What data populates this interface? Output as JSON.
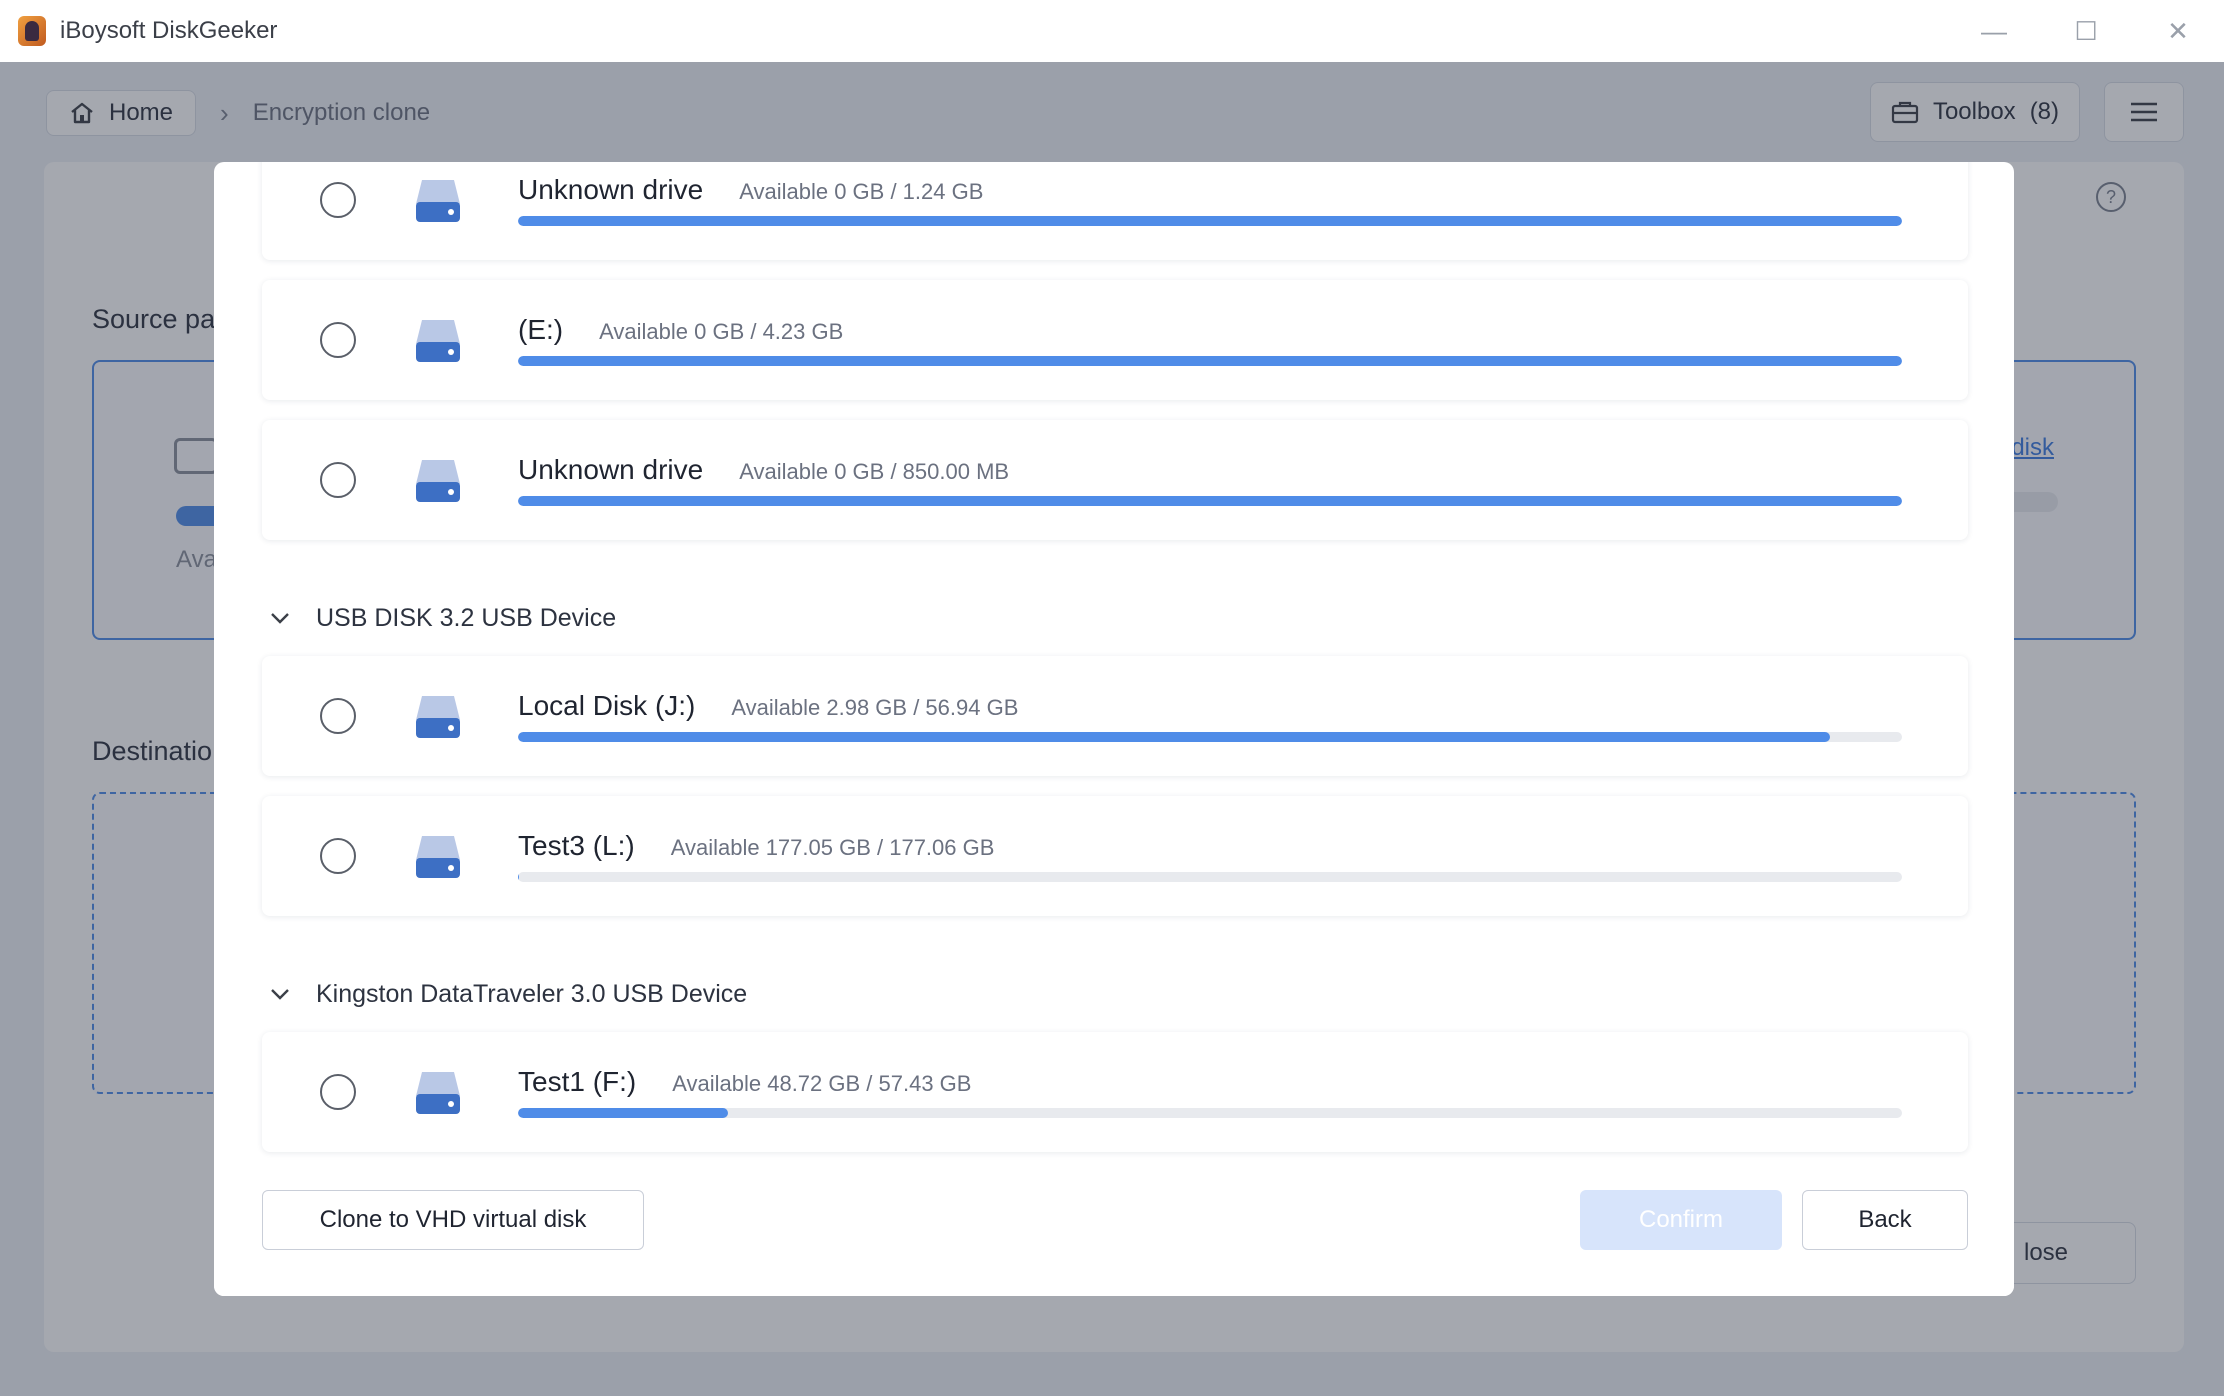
{
  "window": {
    "title": "iBoysoft DiskGeeker",
    "minimize": "—",
    "maximize": "☐",
    "close": "✕"
  },
  "breadcrumb": {
    "home": "Home",
    "current": "Encryption clone"
  },
  "toolbar": {
    "toolbox_label": "Toolbox",
    "toolbox_count": "(8)"
  },
  "background": {
    "source_label": "Source pa",
    "destination_label": "Destinatio",
    "source_avail": "Ava",
    "source_link": "disk",
    "close_button": "lose",
    "help": "?"
  },
  "modal": {
    "drives_top": [
      {
        "name": "Unknown drive",
        "available": "Available 0 GB / 1.24 GB",
        "used_fraction": 1.0
      },
      {
        "name": "(E:)",
        "available": "Available 0 GB / 4.23 GB",
        "used_fraction": 1.0
      },
      {
        "name": "Unknown drive",
        "available": "Available 0 GB / 850.00 MB",
        "used_fraction": 1.0
      }
    ],
    "groups": [
      {
        "name": "USB DISK 3.2 USB Device",
        "drives": [
          {
            "name": "Local Disk (J:)",
            "available": "Available 2.98 GB / 56.94 GB",
            "used_fraction": 0.948
          },
          {
            "name": "Test3 (L:)",
            "available": "Available 177.05 GB / 177.06 GB",
            "used_fraction": 0.001
          }
        ]
      },
      {
        "name": "Kingston DataTraveler 3.0 USB Device",
        "drives": [
          {
            "name": "Test1 (F:)",
            "available": "Available 48.72 GB / 57.43 GB",
            "used_fraction": 0.152
          }
        ]
      }
    ],
    "footer": {
      "vhd_button": "Clone to VHD virtual disk",
      "confirm_button": "Confirm",
      "back_button": "Back"
    }
  },
  "colors": {
    "accent": "#4f8ce8",
    "confirm_disabled": "#d7e4fb"
  }
}
